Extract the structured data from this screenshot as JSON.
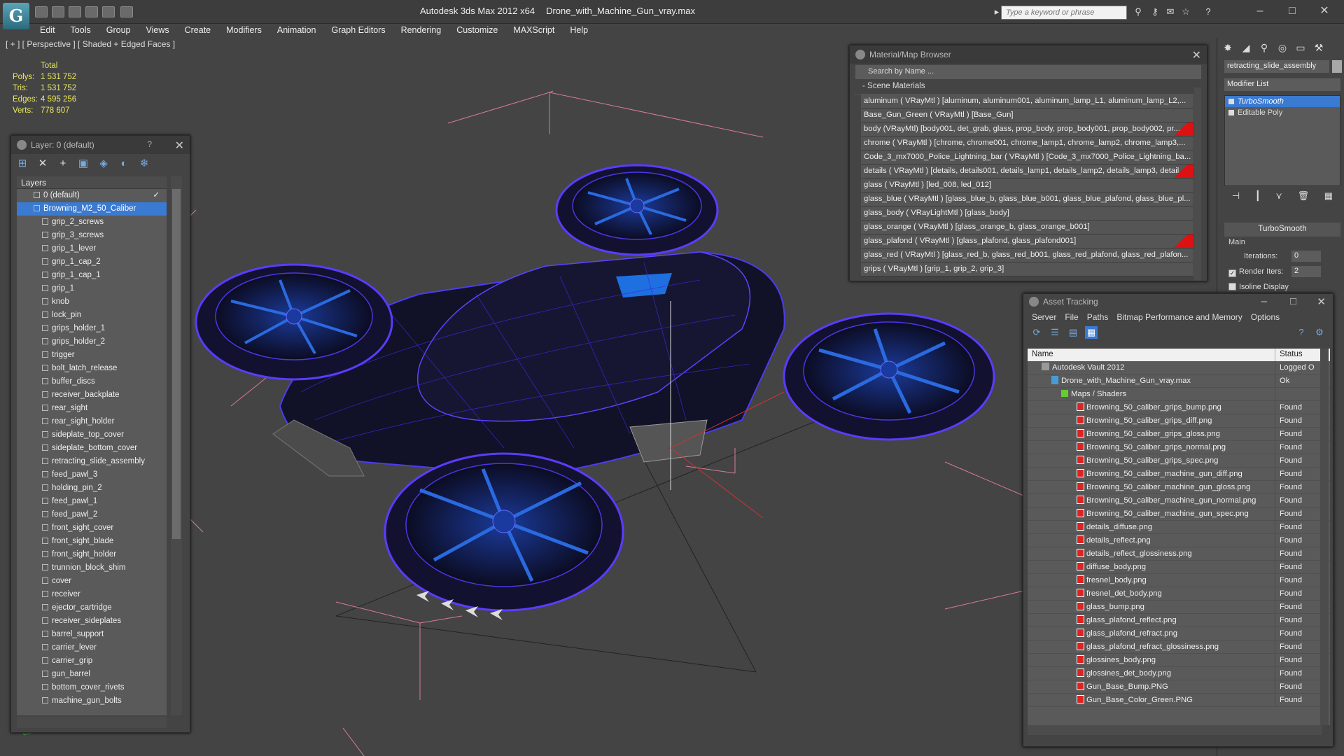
{
  "titlebar": {
    "app": "Autodesk 3ds Max  2012 x64",
    "file": "Drone_with_Machine_Gun_vray.max",
    "search_placeholder": "Type a keyword or phrase"
  },
  "menu": [
    "Edit",
    "Tools",
    "Group",
    "Views",
    "Create",
    "Modifiers",
    "Animation",
    "Graph Editors",
    "Rendering",
    "Customize",
    "MAXScript",
    "Help"
  ],
  "viewport": {
    "label": "[ + ] [ Perspective ] [ Shaded + Edged Faces ]",
    "stats": {
      "header": "Total",
      "rows": [
        {
          "label": "Polys:",
          "value": "1 531 752"
        },
        {
          "label": "Tris:",
          "value": "1 531 752"
        },
        {
          "label": "Edges:",
          "value": "4 595 256"
        },
        {
          "label": "Verts:",
          "value": "778 607"
        }
      ]
    }
  },
  "layer_panel": {
    "title": "Layer: 0 (default)",
    "help": "?",
    "column": "Layers",
    "layers": [
      "0 (default)",
      "Browning_M2_50_Caliber",
      "grip_2_screws",
      "grip_3_screws",
      "grip_1_lever",
      "grip_1_cap_2",
      "grip_1_cap_1",
      "grip_1",
      "knob",
      "lock_pin",
      "grips_holder_1",
      "grips_holder_2",
      "trigger",
      "bolt_latch_release",
      "buffer_discs",
      "receiver_backplate",
      "rear_sight",
      "rear_sight_holder",
      "sideplate_top_cover",
      "sideplate_bottom_cover",
      "retracting_slide_assembly",
      "feed_pawl_3",
      "holding_pin_2",
      "feed_pawl_1",
      "feed_pawl_2",
      "front_sight_cover",
      "front_sight_blade",
      "front_sight_holder",
      "trunnion_block_shim",
      "cover",
      "receiver",
      "ejector_cartridge",
      "receiver_sideplates",
      "barrel_support",
      "carrier_lever",
      "carrier_grip",
      "gun_barrel",
      "bottom_cover_rivets",
      "machine_gun_bolts"
    ]
  },
  "material_browser": {
    "title": "Material/Map Browser",
    "search": "Search by Name ...",
    "section": "- Scene Materials",
    "materials": [
      "aluminum  ( VRayMtl )  [aluminum, aluminum001, aluminum_lamp_L1, aluminum_lamp_L2,...",
      "Base_Gun_Green  ( VRayMtl )  [Base_Gun]",
      "body (VRayMtl) [body001, det_grab, glass, prop_body, prop_body001, prop_body002, pr...",
      "chrome  ( VRayMtl )  [chrome, chrome001, chrome_lamp1, chrome_lamp2, chrome_lamp3,...",
      "Code_3_mx7000_Police_Lightning_bar  ( VRayMtl )  [Code_3_mx7000_Police_Lightning_ba...",
      "details ( VRayMtl ) [details, details001, details_lamp1, details_lamp2, details_lamp3, detail...",
      "glass  ( VRayMtl )  [led_008, led_012]",
      "glass_blue ( VRayMtl ) [glass_blue_b, glass_blue_b001, glass_blue_plafond, glass_blue_pl...",
      "glass_body ( VRayLightMtl ) [glass_body]",
      "glass_orange ( VRayMtl ) [glass_orange_b, glass_orange_b001]",
      "glass_plafond ( VRayMtl ) [glass_plafond, glass_plafond001]",
      "glass_red ( VRayMtl ) [glass_red_b, glass_red_b001, glass_red_plafond, glass_red_plafon...",
      "grips  ( VRayMtl )  [grip_1, grip_2, grip_3]"
    ]
  },
  "command_panel": {
    "object_name": "retracting_slide_assembly",
    "modifier_list": "Modifier List",
    "stack": [
      "TurboSmooth",
      "Editable Poly"
    ],
    "turbosmooth": {
      "title": "TurboSmooth",
      "main": "Main",
      "iterations_label": "Iterations:",
      "iterations": "0",
      "render_iters_label": "Render Iters:",
      "render_iters": "2",
      "isoline": "Isoline Display"
    }
  },
  "asset_tracking": {
    "title": "Asset Tracking",
    "menu": [
      "Server",
      "File",
      "Paths",
      "Bitmap Performance and Memory",
      "Options"
    ],
    "col_name": "Name",
    "col_status": "Status",
    "vault": {
      "name": "Autodesk Vault 2012",
      "status": "Logged O"
    },
    "file": {
      "name": "Drone_with_Machine_Gun_vray.max",
      "status": "Ok"
    },
    "folder": "Maps / Shaders",
    "files": [
      "Browning_50_caliber_grips_bump.png",
      "Browning_50_caliber_grips_diff.png",
      "Browning_50_caliber_grips_gloss.png",
      "Browning_50_caliber_grips_normal.png",
      "Browning_50_caliber_grips_spec.png",
      "Browning_50_caliber_machine_gun_diff.png",
      "Browning_50_caliber_machine_gun_gloss.png",
      "Browning_50_caliber_machine_gun_normal.png",
      "Browning_50_caliber_machine_gun_spec.png",
      "details_diffuse.png",
      "details_reflect.png",
      "details_reflect_glossiness.png",
      "diffuse_body.png",
      "fresnel_body.png",
      "fresnel_det_body.png",
      "glass_bump.png",
      "glass_plafond_reflect.png",
      "glass_plafond_refract.png",
      "glass_plafond_refract_glossiness.png",
      "glossines_body.png",
      "glossines_det_body.png",
      "Gun_Base_Bump.PNG",
      "Gun_Base_Color_Green.PNG"
    ],
    "found": "Found"
  },
  "colors": {
    "accent": "#3a7ad1",
    "stats": "#e8e860",
    "wire": "#5a3cff",
    "mesh": "#141428"
  }
}
